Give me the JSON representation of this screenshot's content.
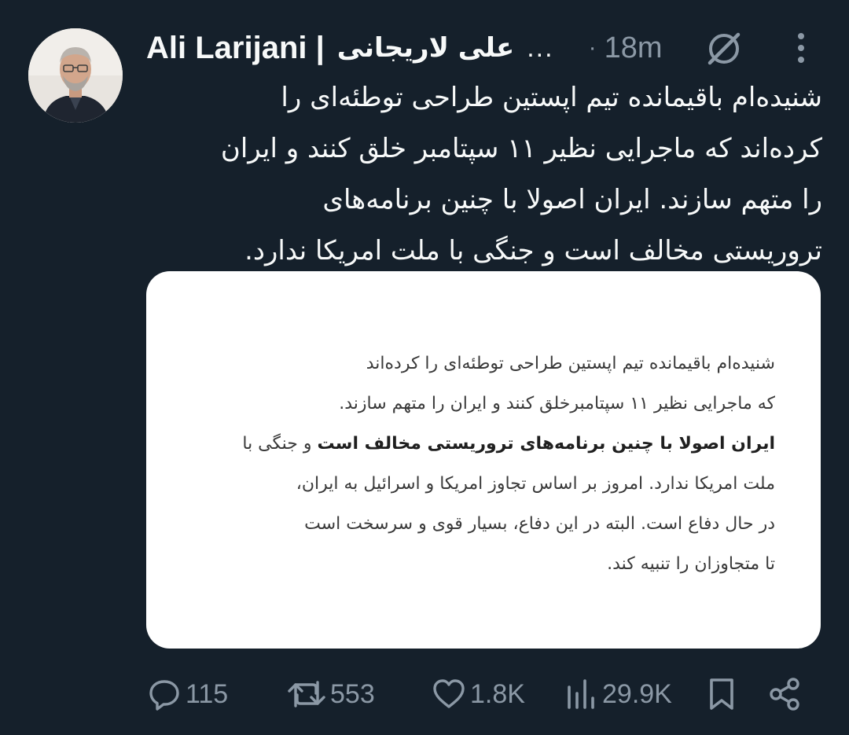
{
  "author": {
    "name_latin": "Ali Larijani |",
    "name_persian": "علی لاریجانی",
    "name_truncation": "...",
    "time_separator": "·",
    "time": "18m"
  },
  "tweet": {
    "lines": [
      "شنیده‌ام باقیمانده تیم اپستین طراحی توطئه‌ای را",
      "کرده‌اند که ماجرایی نظیر ۱۱ سپتامبر خلق کنند و ایران",
      "را متهم سازند. ایران اصولا با چنین برنامه‌های",
      "تروریستی مخالف است و جنگی با ملت امریکا ندارد."
    ]
  },
  "media": {
    "line1": "شنیده‌ام باقیمانده تیم اپستین طراحی توطئه‌ای را کرده‌اند",
    "line2": "که ماجرایی نظیر ۱۱ سپتامبرخلق کنند و ایران را متهم سازند.",
    "line3_bold1": "ایران اصولا با چنین برنامه‌های تروریستی مخالف است",
    "line3_rest": " و جنگی با",
    "line4": "ملت امریکا ندارد. امروز بر اساس تجاوز امریکا و اسرائیل به ایران،",
    "line5": "در حال دفاع است. البته در این دفاع، بسیار قوی و سرسخت است",
    "line6": "تا متجاوزان را تنبیه کند."
  },
  "actions": {
    "replies": "115",
    "reposts": "553",
    "likes": "1.8K",
    "views": "29.9K"
  },
  "icons": {
    "reply": "reply-icon",
    "repost": "repost-icon",
    "like": "heart-icon",
    "views": "views-icon",
    "bookmark": "bookmark-icon",
    "share": "share-icon",
    "grok": "grok-icon",
    "more": "more-vertical-icon"
  },
  "colors": {
    "background": "#15202b",
    "text": "#f7f9f9",
    "secondary": "#8b98a5",
    "card": "#ffffff"
  }
}
